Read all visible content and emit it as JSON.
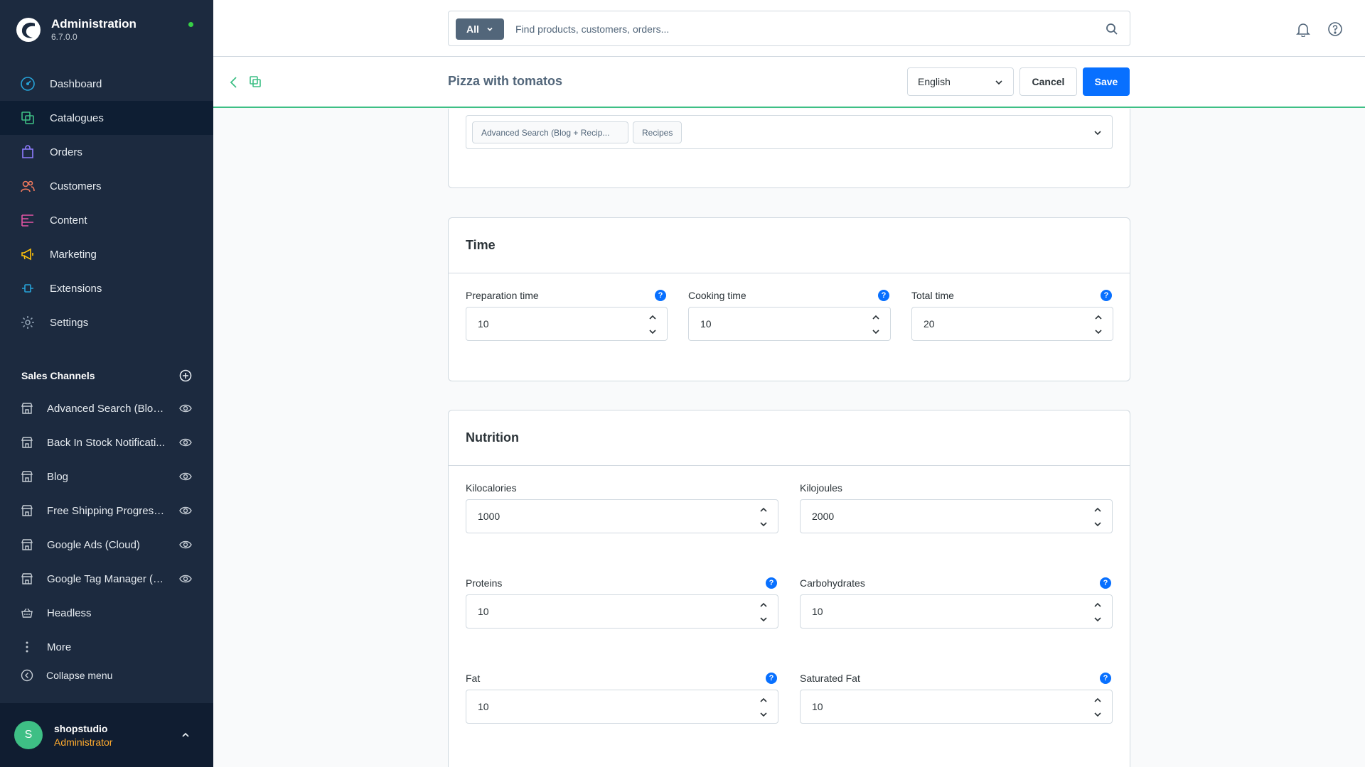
{
  "app": {
    "title": "Administration",
    "version": "6.7.0.0"
  },
  "nav": [
    {
      "label": "Dashboard",
      "icon": "dashboard-icon"
    },
    {
      "label": "Catalogues",
      "icon": "catalogues-icon",
      "active": true
    },
    {
      "label": "Orders",
      "icon": "orders-icon"
    },
    {
      "label": "Customers",
      "icon": "customers-icon"
    },
    {
      "label": "Content",
      "icon": "content-icon"
    },
    {
      "label": "Marketing",
      "icon": "marketing-icon"
    },
    {
      "label": "Extensions",
      "icon": "extensions-icon"
    },
    {
      "label": "Settings",
      "icon": "settings-icon"
    }
  ],
  "sales_channels": {
    "title": "Sales Channels",
    "items": [
      {
        "label": "Advanced Search (Blog ..."
      },
      {
        "label": "Back In Stock Notificati..."
      },
      {
        "label": "Blog"
      },
      {
        "label": "Free Shipping Progress ..."
      },
      {
        "label": "Google Ads (Cloud)"
      },
      {
        "label": "Google Tag Manager (C..."
      },
      {
        "label": "Headless"
      },
      {
        "label": "More"
      }
    ],
    "collapse_label": "Collapse menu"
  },
  "user": {
    "initial": "S",
    "name": "shopstudio",
    "role": "Administrator"
  },
  "search": {
    "type": "All",
    "placeholder": "Find products, customers, orders..."
  },
  "smartbar": {
    "title": "Pizza with tomatos",
    "language": "English",
    "cancel": "Cancel",
    "save": "Save"
  },
  "tags": [
    "Advanced Search (Blog + Recip...",
    "Recipes"
  ],
  "time": {
    "title": "Time",
    "fields": [
      {
        "label": "Preparation time",
        "value": "10"
      },
      {
        "label": "Cooking time",
        "value": "10"
      },
      {
        "label": "Total time",
        "value": "20"
      }
    ]
  },
  "nutrition": {
    "title": "Nutrition",
    "fields": [
      {
        "label": "Kilocalories",
        "value": "1000"
      },
      {
        "label": "Kilojoules",
        "value": "2000"
      },
      {
        "label": "Proteins",
        "value": "10"
      },
      {
        "label": "Carbohydrates",
        "value": "10"
      },
      {
        "label": "Fat",
        "value": "10"
      },
      {
        "label": "Saturated Fat",
        "value": "10"
      }
    ]
  },
  "help_glyph": "?",
  "colors": {
    "sidebar": "#1c2a3f",
    "primary": "#0870ff",
    "accent": "#3ebf85",
    "role": "#ffab2e"
  }
}
